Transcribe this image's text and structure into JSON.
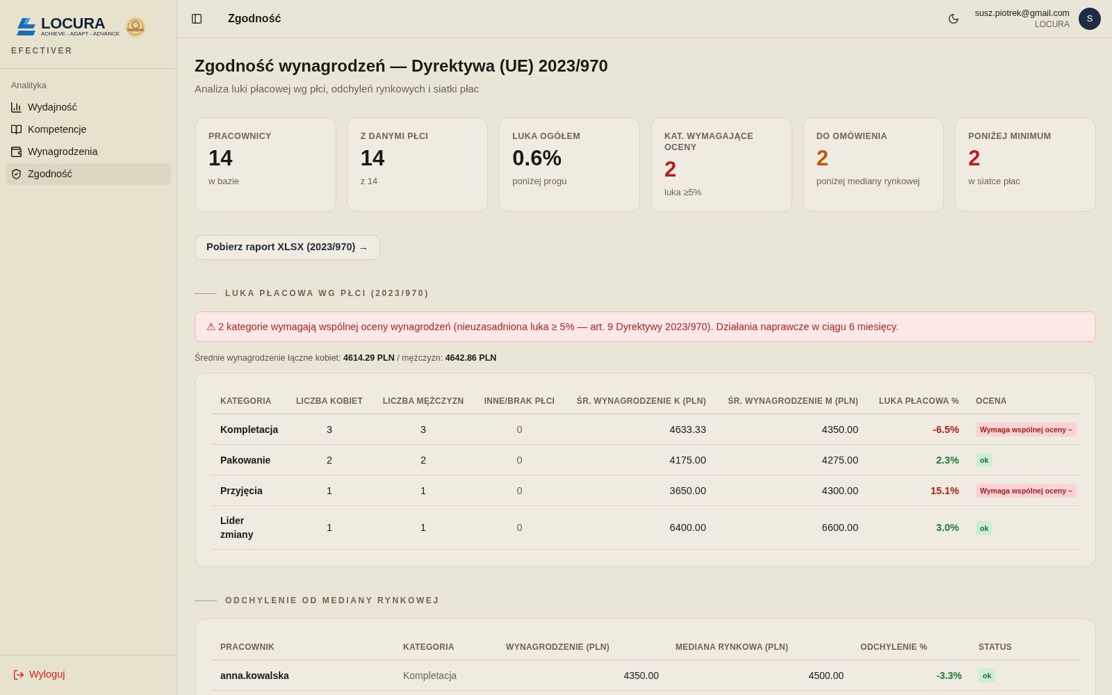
{
  "sidebar": {
    "logo": {
      "name": "LOCURA",
      "tagline": "ACHIEVE - ADAPT - ADVANCE"
    },
    "app_name": "EFECTIVER",
    "section_label": "Analityka",
    "items": [
      {
        "label": "Wydajność",
        "selected": false
      },
      {
        "label": "Kompetencje",
        "selected": false
      },
      {
        "label": "Wynagrodzenia",
        "selected": false
      },
      {
        "label": "Zgodność",
        "selected": true
      }
    ],
    "logout": "Wyloguj"
  },
  "top_bar": {
    "title": "Zgodność",
    "user": {
      "email": "susz.piotrek@gmail.com",
      "organization": "LOCURA",
      "avatar_initial": "S"
    }
  },
  "page": {
    "title": "Zgodność wynagrodzeń — Dyrektywa (UE) 2023/970",
    "subtitle": "Analiza luki płacowej wg płci, odchyleń rynkowych i siatki płac"
  },
  "kpis": [
    {
      "label": "PRACOWNICY",
      "value": "14",
      "note": "w bazie",
      "color": "#1c1a16"
    },
    {
      "label": "Z DANYMI PŁCI",
      "value": "14",
      "note": "z 14",
      "color": "#1c1a16"
    },
    {
      "label": "LUKA OGÓŁEM",
      "value": "0.6%",
      "note": "poniżej progu",
      "color": "#1c1a16"
    },
    {
      "label": "KAT. WYMAGAJĄCE OCENY",
      "value": "2",
      "note": "luka ≥5%",
      "color": "#b91c1c"
    },
    {
      "label": "DO OMÓWIENIA",
      "value": "2",
      "note": "poniżej mediany rynkowej",
      "color": "#c2570c"
    },
    {
      "label": "PONIŻEJ MINIMUM",
      "value": "2",
      "note": "w siatce płac",
      "color": "#b91c1c"
    }
  ],
  "download_button": "Pobierz raport XLSX (2023/970) →",
  "gender_pay_gap": {
    "heading": "LUKA PŁACOWA WG PŁCI (2023/970)",
    "alert": "⚠ 2 kategorie wymagają wspólnej oceny wynagrodzeń (nieuzasadniona luka ≥ 5% — art. 9 Dyrektywy 2023/970). Działania naprawcze w ciągu 6 miesięcy.",
    "summary": "Średnie wynagrodzenie łączne kobiet: **4614.29 PLN** / mężczyzn: **4642.86 PLN**",
    "table": {
      "columns": [
        "KATEGORIA",
        "LICZBA KOBIET",
        "LICZBA MĘŻCZYZN",
        "INNE/BRAK PŁCI",
        "ŚR. WYNAGRODZENIE K (PLN)",
        "ŚR. WYNAGRODZENIE M (PLN)",
        "LUKA PŁACOWA %",
        "OCENA"
      ],
      "rows": [
        {
          "cells": [
            "Kompletacja",
            "3",
            "3",
            "0",
            "4633.33",
            "4350.00",
            "-6.5%",
            "Wymaga wspólnej oceny –"
          ],
          "flagged": true
        },
        {
          "cells": [
            "Pakowanie",
            "2",
            "2",
            "0",
            "4175.00",
            "4275.00",
            "2.3%",
            "ok"
          ],
          "flagged": false
        },
        {
          "cells": [
            "Przyjęcia",
            "1",
            "1",
            "0",
            "3650.00",
            "4300.00",
            "15.1%",
            "Wymaga wspólnej oceny –"
          ],
          "flagged": true
        },
        {
          "cells": [
            "Lider zmiany",
            "1",
            "1",
            "0",
            "6400.00",
            "6600.00",
            "3.0%",
            "ok"
          ],
          "flagged": false
        }
      ]
    }
  },
  "market_deviation": {
    "heading": "ODCHYLENIE OD MEDIANY RYNKOWEJ",
    "table": {
      "columns": [
        "PRACOWNIK",
        "KATEGORIA",
        "WYNAGRODZENIE (PLN)",
        "MEDIANA RYNKOWA (PLN)",
        "ODCHYLENIE %",
        "STATUS"
      ],
      "rows": [
        {
          "cells": [
            "anna.kowalska",
            "Kompletacja",
            "4350.00",
            "4500.00",
            "-3.3%",
            "ok"
          ],
          "flagged": false
        }
      ]
    }
  }
}
